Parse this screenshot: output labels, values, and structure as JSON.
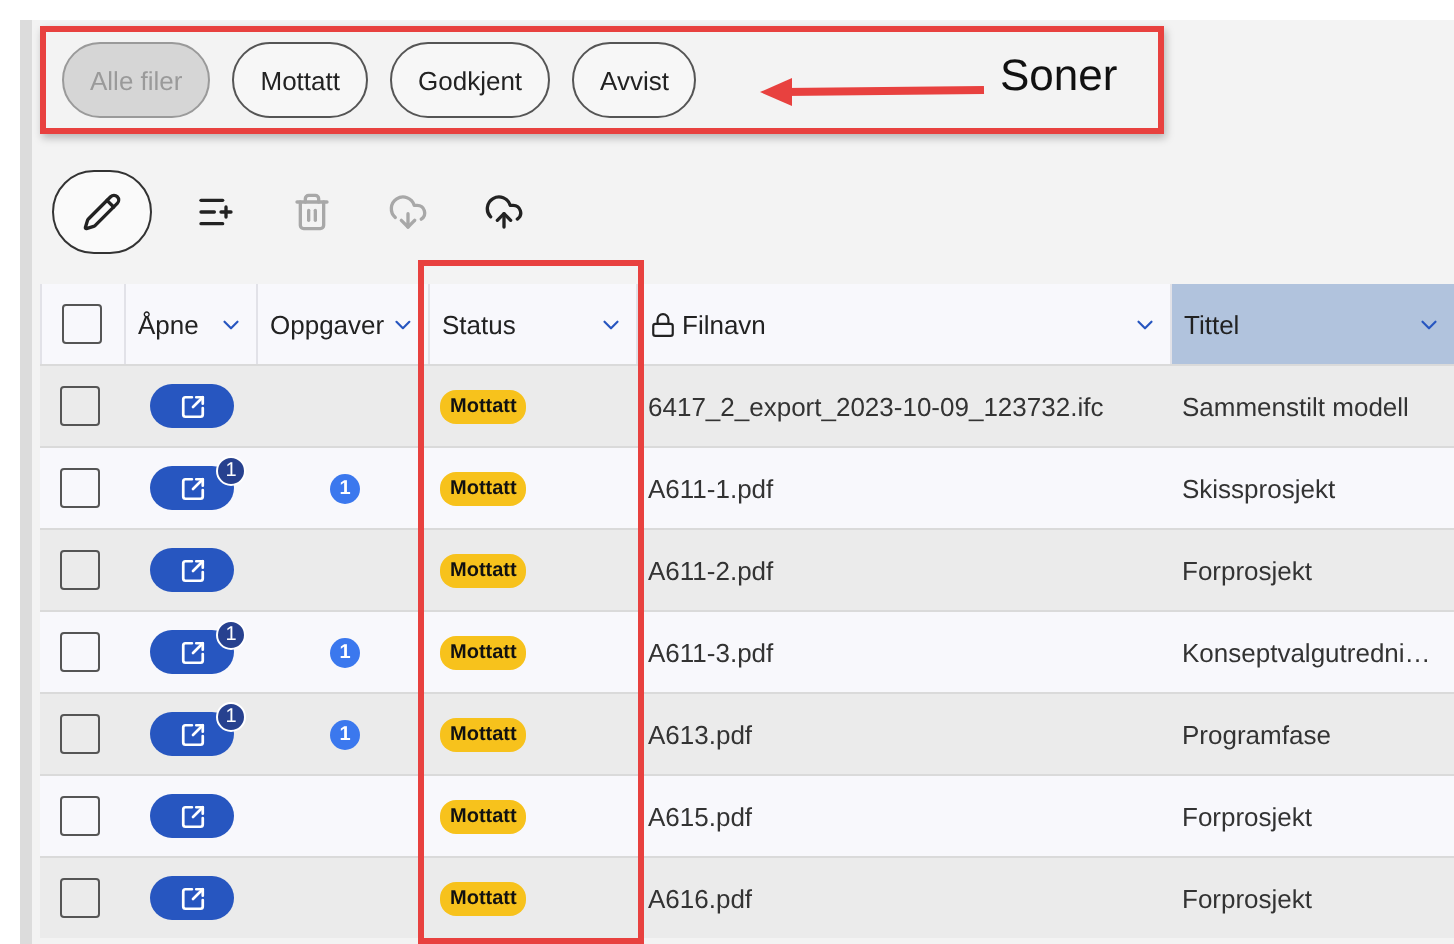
{
  "zones": [
    {
      "label": "Alle filer",
      "selected": true
    },
    {
      "label": "Mottatt",
      "selected": false
    },
    {
      "label": "Godkjent",
      "selected": false
    },
    {
      "label": "Avvist",
      "selected": false
    }
  ],
  "annotation": {
    "label": "Soner"
  },
  "toolbar": [
    {
      "kind": "edit",
      "disabled": false
    },
    {
      "kind": "add-list",
      "disabled": false
    },
    {
      "kind": "delete",
      "disabled": true
    },
    {
      "kind": "download",
      "disabled": true
    },
    {
      "kind": "upload",
      "disabled": false
    }
  ],
  "table": {
    "header_checked": false,
    "columns": [
      {
        "label": "Åpne",
        "kind": "plain",
        "highlighted": false
      },
      {
        "label": "Oppgaver",
        "kind": "plain",
        "highlighted": false
      },
      {
        "label": "Status",
        "kind": "plain",
        "highlighted": false
      },
      {
        "label": "Filnavn",
        "kind": "locked",
        "highlighted": false
      },
      {
        "label": "Tittel",
        "kind": "plain",
        "highlighted": true
      }
    ],
    "rows": [
      {
        "checked": false,
        "open_badge": "",
        "tasks": "",
        "status": "Mottatt",
        "filename": "6417_2_export_2023-10-09_123732.ifc",
        "title": "Sammenstilt modell"
      },
      {
        "checked": false,
        "open_badge": "1",
        "tasks": "1",
        "status": "Mottatt",
        "filename": "A611-1.pdf",
        "title": "Skissprosjekt"
      },
      {
        "checked": false,
        "open_badge": "",
        "tasks": "",
        "status": "Mottatt",
        "filename": "A611-2.pdf",
        "title": "Forprosjekt"
      },
      {
        "checked": false,
        "open_badge": "1",
        "tasks": "1",
        "status": "Mottatt",
        "filename": "A611-3.pdf",
        "title": "Konseptvalgutredni…"
      },
      {
        "checked": false,
        "open_badge": "1",
        "tasks": "1",
        "status": "Mottatt",
        "filename": "A613.pdf",
        "title": "Programfase"
      },
      {
        "checked": false,
        "open_badge": "",
        "tasks": "",
        "status": "Mottatt",
        "filename": "A615.pdf",
        "title": "Forprosjekt"
      },
      {
        "checked": false,
        "open_badge": "",
        "tasks": "",
        "status": "Mottatt",
        "filename": "A616.pdf",
        "title": "Forprosjekt"
      }
    ]
  }
}
